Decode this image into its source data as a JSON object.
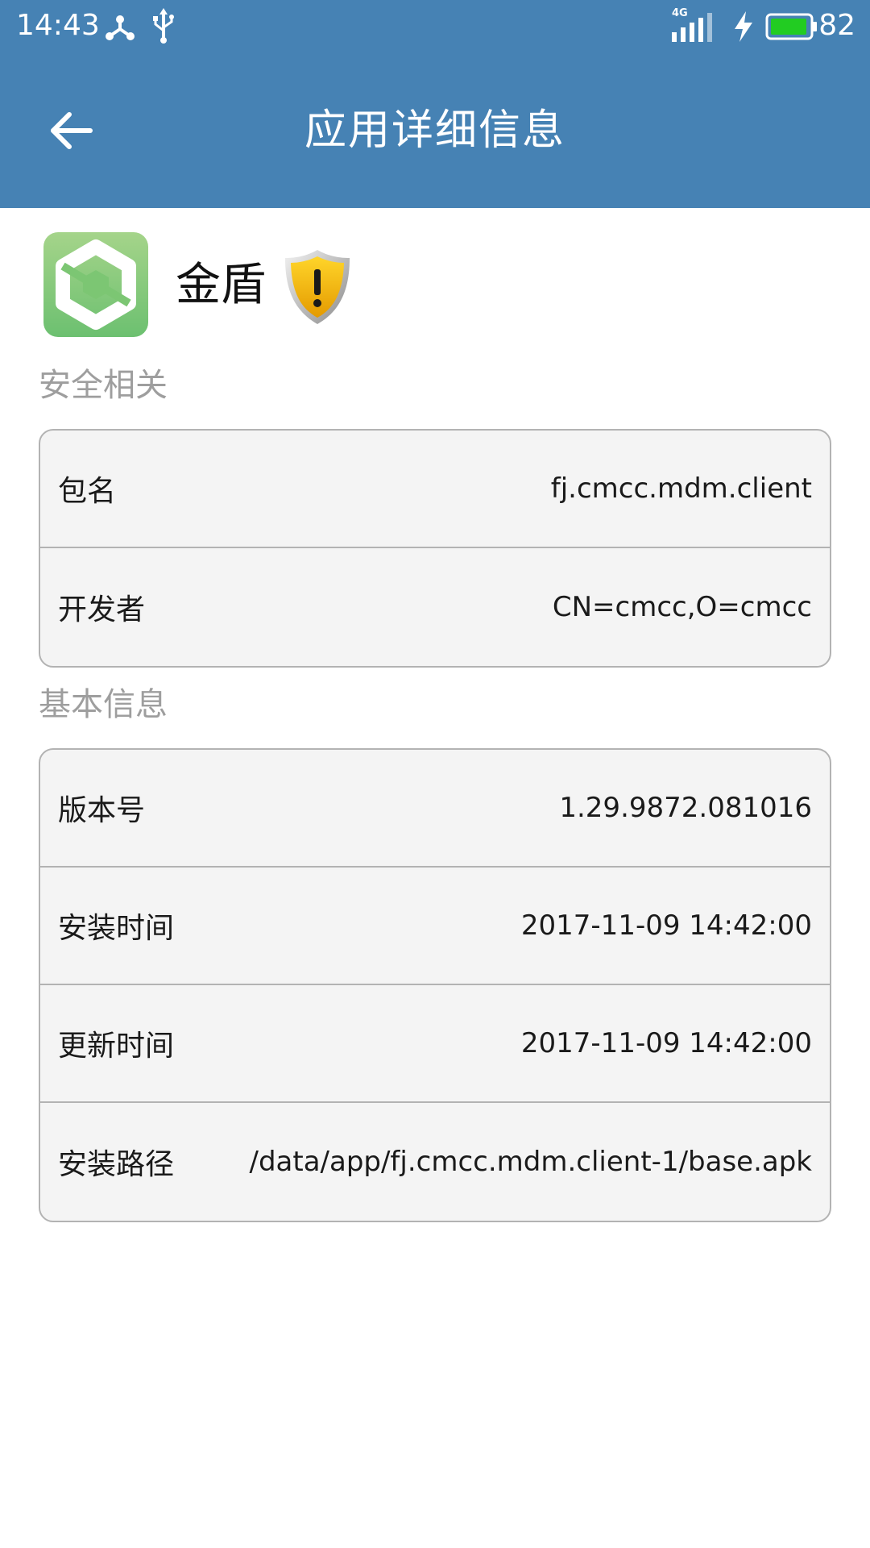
{
  "status_bar": {
    "time": "14:43",
    "network": "4G",
    "battery_percent": "82",
    "icons": [
      "usb-tether-icon",
      "usb-icon",
      "signal-icon",
      "charging-icon",
      "battery-icon"
    ]
  },
  "app_bar": {
    "title": "应用详细信息",
    "back_icon": "arrow-left-icon"
  },
  "app": {
    "name": "金盾",
    "icon": "app-logo-icon",
    "status_icon": "warning-shield-icon"
  },
  "sections": [
    {
      "label": "安全相关",
      "rows": [
        {
          "label": "包名",
          "value": "fj.cmcc.mdm.client"
        },
        {
          "label": "开发者",
          "value": "CN=cmcc,O=cmcc"
        }
      ]
    },
    {
      "label": "基本信息",
      "rows": [
        {
          "label": "版本号",
          "value": "1.29.9872.081016"
        },
        {
          "label": "安装时间",
          "value": "2017-11-09 14:42:00"
        },
        {
          "label": "更新时间",
          "value": "2017-11-09 14:42:00"
        },
        {
          "label": "安装路径",
          "value": "/data/app/fj.cmcc.mdm.client-1/base.apk"
        }
      ]
    }
  ],
  "colors": {
    "primary": "#4682b4",
    "card_bg": "#f4f4f4",
    "card_border": "#b3b3b3",
    "section_label": "#9e9e9e",
    "battery_fill": "#22cc22"
  }
}
